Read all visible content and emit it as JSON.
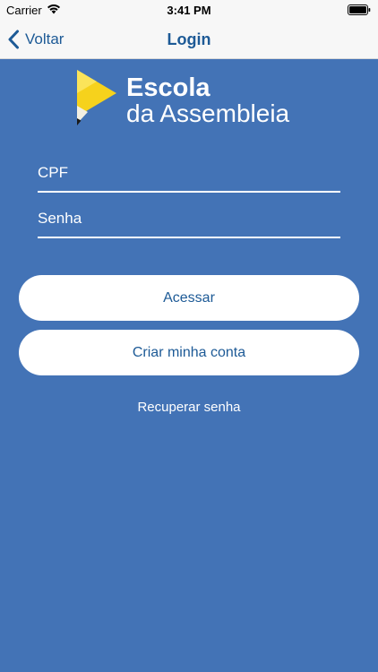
{
  "status_bar": {
    "carrier": "Carrier",
    "time": "3:41 PM",
    "wifi_icon": "wifi-icon",
    "battery_icon": "battery-icon"
  },
  "nav": {
    "back_label": "Voltar",
    "back_icon": "chevron-left-icon",
    "title": "Login"
  },
  "logo": {
    "line1": "Escola",
    "line2": "da Assembleia",
    "mark_icon": "pencil-play-logo"
  },
  "form": {
    "cpf_placeholder": "CPF",
    "cpf_value": "",
    "senha_placeholder": "Senha",
    "senha_value": ""
  },
  "actions": {
    "acessar_label": "Acessar",
    "criar_label": "Criar minha conta",
    "recover_label": "Recuperar senha"
  },
  "colors": {
    "background": "#4373b6",
    "accent": "#1d5a96",
    "bar_background": "#f7f7f7",
    "logo_yellow": "#f6d21c"
  }
}
